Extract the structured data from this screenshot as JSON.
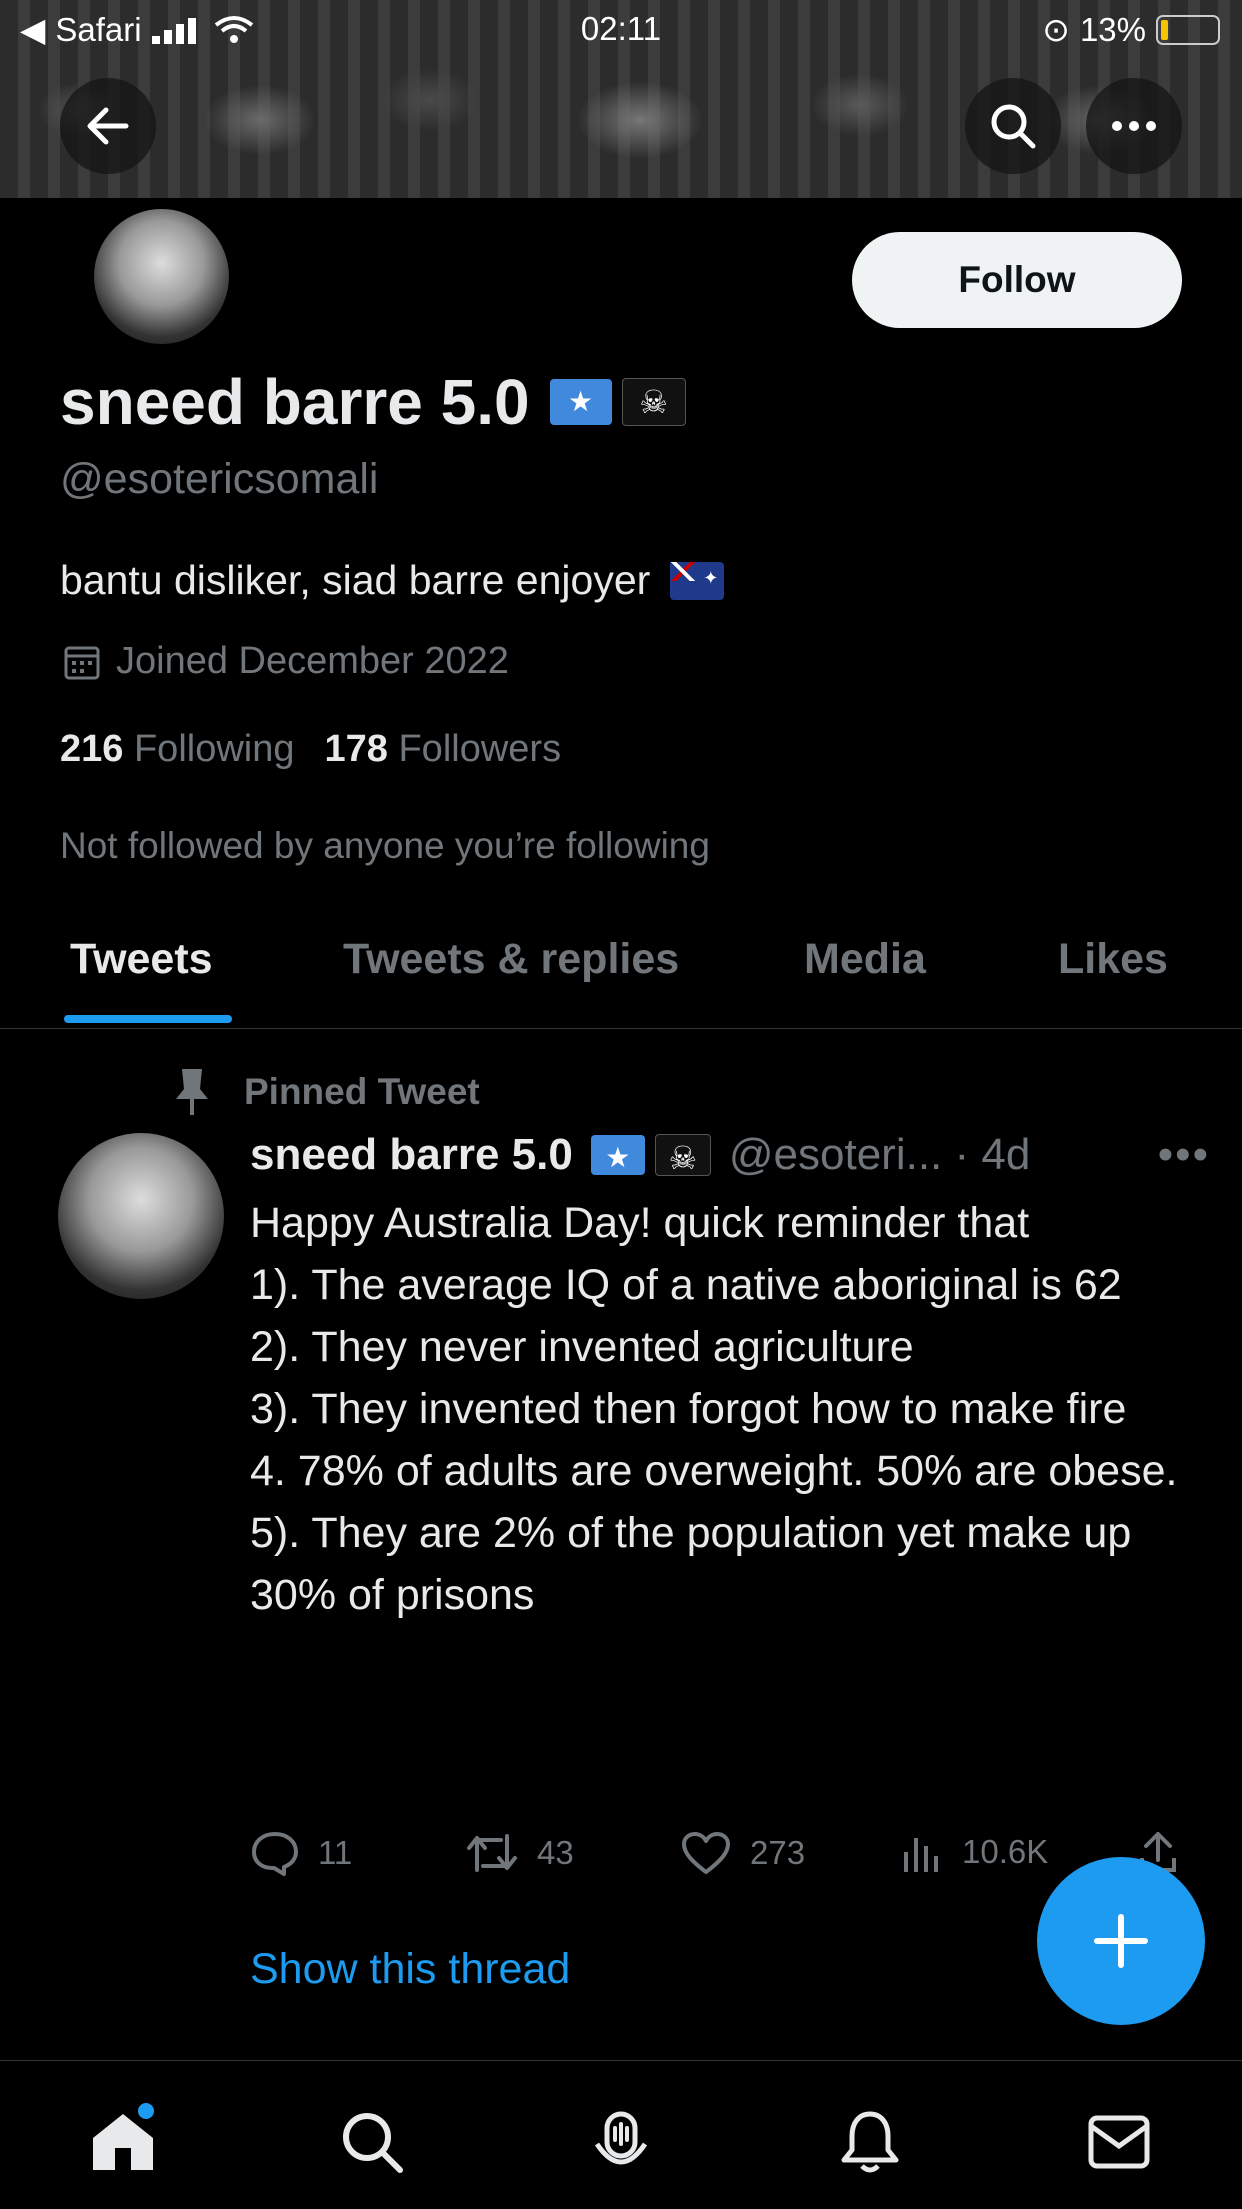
{
  "status_bar": {
    "back_app": "Safari",
    "time": "02:11",
    "battery_percent": "13%"
  },
  "profile": {
    "display_name": "sneed barre 5.0",
    "handle": "@esotericsomali",
    "bio": "bantu disliker, siad barre enjoyer",
    "joined": "Joined December 2022",
    "following_count": "216",
    "following_label": "Following",
    "followers_count": "178",
    "followers_label": "Followers",
    "not_followed_note": "Not followed by anyone you’re following",
    "follow_button": "Follow"
  },
  "tabs": [
    {
      "label": "Tweets",
      "active": true
    },
    {
      "label": "Tweets & replies",
      "active": false
    },
    {
      "label": "Media",
      "active": false
    },
    {
      "label": "Likes",
      "active": false
    }
  ],
  "pinned_tweet": {
    "pinned_label": "Pinned Tweet",
    "author_name": "sneed barre 5.0",
    "author_handle": "@esoteri... · 4d",
    "text": "Happy Australia Day! quick reminder that\n1). The average IQ of a native aboriginal is 62\n2). They never invented agriculture\n3). They invented then forgot how to make fire\n4. 78% of adults are overweight. 50% are obese.\n5). They are 2% of the population yet make up 30% of prisons",
    "replies": "11",
    "retweets": "43",
    "likes": "273",
    "views": "10.6K",
    "show_thread": "Show this thread"
  },
  "colors": {
    "accent": "#1d9bf0",
    "background": "#000000",
    "text": "#e7e9ea",
    "muted": "#71767b"
  }
}
